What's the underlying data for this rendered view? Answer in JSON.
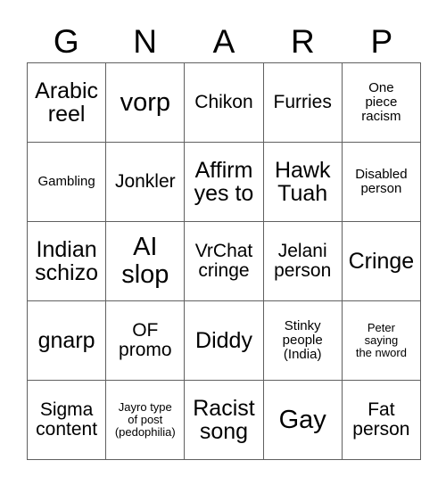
{
  "card": {
    "headers": [
      "G",
      "N",
      "A",
      "R",
      "P"
    ],
    "border_color": "#606060",
    "background_color": "#ffffff",
    "text_color": "#000000",
    "rows": [
      [
        {
          "text": "Arabic\nreel",
          "size": "lg"
        },
        {
          "text": "vorp",
          "size": "xl"
        },
        {
          "text": "Chikon",
          "size": "md"
        },
        {
          "text": "Furries",
          "size": "md"
        },
        {
          "text": "One\npiece\nracism",
          "size": "sm"
        }
      ],
      [
        {
          "text": "Gambling",
          "size": "sm"
        },
        {
          "text": "Jonkler",
          "size": "md"
        },
        {
          "text": "Affirm\nyes to",
          "size": "lg"
        },
        {
          "text": "Hawk\nTuah",
          "size": "lg"
        },
        {
          "text": "Disabled\nperson",
          "size": "sm"
        }
      ],
      [
        {
          "text": "Indian\nschizo",
          "size": "lg"
        },
        {
          "text": "AI\nslop",
          "size": "xl"
        },
        {
          "text": "VrChat\ncringe",
          "size": "md"
        },
        {
          "text": "Jelani\nperson",
          "size": "md"
        },
        {
          "text": "Cringe",
          "size": "lg"
        }
      ],
      [
        {
          "text": "gnarp",
          "size": "lg"
        },
        {
          "text": "OF\npromo",
          "size": "md"
        },
        {
          "text": "Diddy",
          "size": "lg"
        },
        {
          "text": "Stinky\npeople\n(India)",
          "size": "sm"
        },
        {
          "text": "Peter\nsaying\nthe nword",
          "size": "xs"
        }
      ],
      [
        {
          "text": "Sigma\ncontent",
          "size": "md"
        },
        {
          "text": "Jayro type\nof post\n(pedophilia)",
          "size": "xs"
        },
        {
          "text": "Racist\nsong",
          "size": "lg"
        },
        {
          "text": "Gay",
          "size": "xl"
        },
        {
          "text": "Fat\nperson",
          "size": "md"
        }
      ]
    ]
  }
}
